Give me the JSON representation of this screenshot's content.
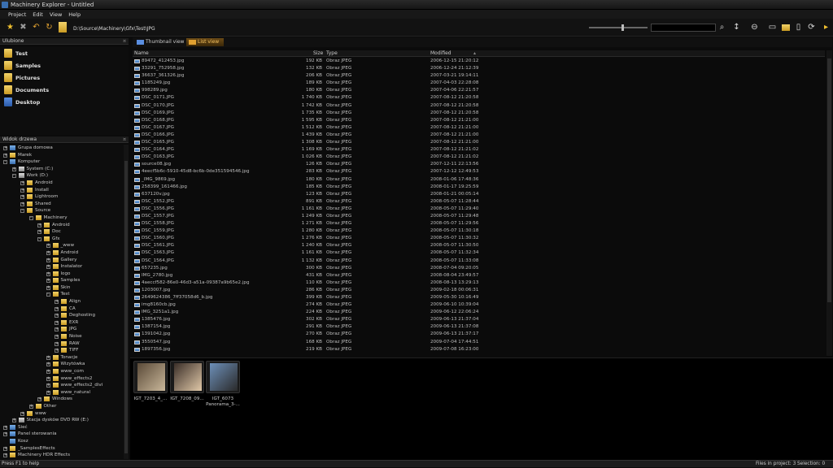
{
  "window": {
    "title": "Machinery Explorer - Untitled"
  },
  "menu": [
    "Project",
    "Edit",
    "View",
    "Help"
  ],
  "toolbar": {
    "path": "D:\\Source\\Machinery\\Gfx\\Test\\JPG"
  },
  "favorites": {
    "header": "Ulubione",
    "items": [
      {
        "label": "Test",
        "icon": "folder-icon"
      },
      {
        "label": "Samples",
        "icon": "folder-icon"
      },
      {
        "label": "Pictures",
        "icon": "folder-icon"
      },
      {
        "label": "Documents",
        "icon": "folder-icon"
      },
      {
        "label": "Desktop",
        "icon": "desktop-icon"
      }
    ]
  },
  "tree": {
    "header": "Widok drzewa",
    "items": [
      {
        "label": "Grupa domowa",
        "depth": 0,
        "exp": "+",
        "icon": "comp"
      },
      {
        "label": "Marek",
        "depth": 0,
        "exp": "+",
        "icon": "folder"
      },
      {
        "label": "Komputer",
        "depth": 0,
        "exp": "-",
        "icon": "comp"
      },
      {
        "label": "System (C:)",
        "depth": 1,
        "exp": "+",
        "icon": "drv"
      },
      {
        "label": "Work (D:)",
        "depth": 1,
        "exp": "-",
        "icon": "drv"
      },
      {
        "label": "Android",
        "depth": 2,
        "exp": "+",
        "icon": "folder"
      },
      {
        "label": "Install",
        "depth": 2,
        "exp": "+",
        "icon": "folder"
      },
      {
        "label": "Lightroom",
        "depth": 2,
        "exp": "+",
        "icon": "folder"
      },
      {
        "label": "Shared",
        "depth": 2,
        "exp": "+",
        "icon": "folder"
      },
      {
        "label": "Source",
        "depth": 2,
        "exp": "-",
        "icon": "folder"
      },
      {
        "label": "Machinery",
        "depth": 3,
        "exp": "-",
        "icon": "folder"
      },
      {
        "label": "Android",
        "depth": 4,
        "exp": "+",
        "icon": "folder"
      },
      {
        "label": "Doc",
        "depth": 4,
        "exp": "+",
        "icon": "folder"
      },
      {
        "label": "Gfx",
        "depth": 4,
        "exp": "-",
        "icon": "folder"
      },
      {
        "label": "_www",
        "depth": 5,
        "exp": "+",
        "icon": "folder"
      },
      {
        "label": "Android",
        "depth": 5,
        "exp": "+",
        "icon": "folder"
      },
      {
        "label": "Gallery",
        "depth": 5,
        "exp": "+",
        "icon": "folder"
      },
      {
        "label": "Instalator",
        "depth": 5,
        "exp": "+",
        "icon": "folder"
      },
      {
        "label": "logo",
        "depth": 5,
        "exp": "+",
        "icon": "folder"
      },
      {
        "label": "Samples",
        "depth": 5,
        "exp": "+",
        "icon": "folder"
      },
      {
        "label": "Skin",
        "depth": 5,
        "exp": "+",
        "icon": "folder"
      },
      {
        "label": "Test",
        "depth": 5,
        "exp": "-",
        "icon": "folder"
      },
      {
        "label": "Align",
        "depth": 6,
        "exp": "+",
        "icon": "folder"
      },
      {
        "label": "CA",
        "depth": 6,
        "exp": "+",
        "icon": "folder"
      },
      {
        "label": "Deghosting",
        "depth": 6,
        "exp": "+",
        "icon": "folder"
      },
      {
        "label": "EXR",
        "depth": 6,
        "exp": "+",
        "icon": "folder"
      },
      {
        "label": "JPG",
        "depth": 6,
        "exp": "+",
        "icon": "folder"
      },
      {
        "label": "Noise",
        "depth": 6,
        "exp": "+",
        "icon": "folder"
      },
      {
        "label": "RAW",
        "depth": 6,
        "exp": "+",
        "icon": "folder"
      },
      {
        "label": "TIFF",
        "depth": 6,
        "exp": "+",
        "icon": "folder"
      },
      {
        "label": "Tonacje",
        "depth": 5,
        "exp": "+",
        "icon": "folder"
      },
      {
        "label": "Wizytówka",
        "depth": 5,
        "exp": "+",
        "icon": "folder"
      },
      {
        "label": "www_com",
        "depth": 5,
        "exp": "+",
        "icon": "folder"
      },
      {
        "label": "www_effects2",
        "depth": 5,
        "exp": "+",
        "icon": "folder"
      },
      {
        "label": "www_effects2_divi",
        "depth": 5,
        "exp": "+",
        "icon": "folder"
      },
      {
        "label": "www_natural",
        "depth": 5,
        "exp": "+",
        "icon": "folder"
      },
      {
        "label": "Windows",
        "depth": 4,
        "exp": "+",
        "icon": "folder"
      },
      {
        "label": "Other",
        "depth": 3,
        "exp": "+",
        "icon": "folder"
      },
      {
        "label": "www",
        "depth": 2,
        "exp": "+",
        "icon": "folder"
      },
      {
        "label": "Stacja dysków DVD RW (E:)",
        "depth": 1,
        "exp": "+",
        "icon": "drv"
      },
      {
        "label": "Sieć",
        "depth": 0,
        "exp": "+",
        "icon": "comp"
      },
      {
        "label": "Panel sterowania",
        "depth": 0,
        "exp": "+",
        "icon": "comp"
      },
      {
        "label": "Kosz",
        "depth": 0,
        "exp": "",
        "icon": "comp"
      },
      {
        "label": "_SamplesEffects",
        "depth": 0,
        "exp": "+",
        "icon": "folder"
      },
      {
        "label": "Machinery HDR Effects",
        "depth": 0,
        "exp": "+",
        "icon": "folder"
      }
    ]
  },
  "view_tabs": [
    {
      "label": "Thumbnail view"
    },
    {
      "label": "List view"
    }
  ],
  "list": {
    "columns": {
      "name": "Name",
      "size": "Size",
      "type": "Type",
      "modified": "Modified"
    },
    "rows": [
      [
        "89472_412453.jpg",
        "192 KB",
        "Obraz JPEG",
        "2006-12-15 21:20:12"
      ],
      [
        "33291_752958.jpg",
        "132 KB",
        "Obraz JPEG",
        "2006-12-24 21:12:39"
      ],
      [
        "36637_361326.jpg",
        "206 KB",
        "Obraz JPEG",
        "2007-03-21 19:14:11"
      ],
      [
        "1185249.jpg",
        "189 KB",
        "Obraz JPEG",
        "2007-04-03 22:28:08"
      ],
      [
        "998289.jpg",
        "180 KB",
        "Obraz JPEG",
        "2007-04-06 22:21:57"
      ],
      [
        "DSC_0171.JPG",
        "1 740 KB",
        "Obraz JPEG",
        "2007-08-12 21:20:58"
      ],
      [
        "DSC_0170.JPG",
        "1 742 KB",
        "Obraz JPEG",
        "2007-08-12 21:20:58"
      ],
      [
        "DSC_0169.JPG",
        "1 735 KB",
        "Obraz JPEG",
        "2007-08-12 21:20:58"
      ],
      [
        "DSC_0168.JPG",
        "1 595 KB",
        "Obraz JPEG",
        "2007-08-12 21:21:00"
      ],
      [
        "DSC_0167.JPG",
        "1 512 KB",
        "Obraz JPEG",
        "2007-08-12 21:21:00"
      ],
      [
        "DSC_0166.JPG",
        "1 439 KB",
        "Obraz JPEG",
        "2007-08-12 21:21:00"
      ],
      [
        "DSC_0165.JPG",
        "1 308 KB",
        "Obraz JPEG",
        "2007-08-12 21:21:00"
      ],
      [
        "DSC_0164.JPG",
        "1 169 KB",
        "Obraz JPEG",
        "2007-08-12 21:21:02"
      ],
      [
        "DSC_0163.JPG",
        "1 026 KB",
        "Obraz JPEG",
        "2007-08-12 21:21:02"
      ],
      [
        "source08.jpg",
        "126 KB",
        "Obraz JPEG",
        "2007-12-11 22:13:56"
      ],
      [
        "4eecf5b6c-5910-45d8-bc6b-0de351594546.jpg",
        "283 KB",
        "Obraz JPEG",
        "2007-12-12 12:49:53"
      ],
      [
        "_IMG_9869.jpg",
        "180 KB",
        "Obraz JPEG",
        "2008-01-06 17:48:36"
      ],
      [
        "258399_161466.jpg",
        "185 KB",
        "Obraz JPEG",
        "2008-01-17 19:25:59"
      ],
      [
        "637120v.jpg",
        "123 KB",
        "Obraz JPEG",
        "2008-01-21 00:05:14"
      ],
      [
        "DSC_1552.JPG",
        "891 KB",
        "Obraz JPEG",
        "2008-05-07 11:28:44"
      ],
      [
        "DSC_1556.JPG",
        "1 161 KB",
        "Obraz JPEG",
        "2008-05-07 11:29:40"
      ],
      [
        "DSC_1557.JPG",
        "1 249 KB",
        "Obraz JPEG",
        "2008-05-07 11:29:48"
      ],
      [
        "DSC_1558.JPG",
        "1 271 KB",
        "Obraz JPEG",
        "2008-05-07 11:29:56"
      ],
      [
        "DSC_1559.JPG",
        "1 280 KB",
        "Obraz JPEG",
        "2008-05-07 11:30:18"
      ],
      [
        "DSC_1560.JPG",
        "1 276 KB",
        "Obraz JPEG",
        "2008-05-07 11:30:32"
      ],
      [
        "DSC_1561.JPG",
        "1 240 KB",
        "Obraz JPEG",
        "2008-05-07 11:30:50"
      ],
      [
        "DSC_1563.JPG",
        "1 161 KB",
        "Obraz JPEG",
        "2008-05-07 11:32:34"
      ],
      [
        "DSC_1564.JPG",
        "1 132 KB",
        "Obraz JPEG",
        "2008-05-07 11:33:08"
      ],
      [
        "657235.jpg",
        "300 KB",
        "Obraz JPEG",
        "2008-07-04 09:20:05"
      ],
      [
        "IMG_2780.jpg",
        "431 KB",
        "Obraz JPEG",
        "2008-08-04 23:49:57"
      ],
      [
        "4aeccf582-86e0-46d3-a51a-09387a9b65e2.jpg",
        "110 KB",
        "Obraz JPEG",
        "2008-08-13 13:29:13"
      ],
      [
        "1203007.jpg",
        "286 KB",
        "Obraz JPEG",
        "2009-02-18 00:06:31"
      ],
      [
        "2649624386_7ff37058d6_b.jpg",
        "399 KB",
        "Obraz JPEG",
        "2009-05-30 10:16:49"
      ],
      [
        "img8160cb.jpg",
        "274 KB",
        "Obraz JPEG",
        "2009-06-10 10:39:04"
      ],
      [
        "IMG_3251a1.jpg",
        "224 KB",
        "Obraz JPEG",
        "2009-06-12 22:06:24"
      ],
      [
        "1385476.jpg",
        "302 KB",
        "Obraz JPEG",
        "2009-06-13 21:37:04"
      ],
      [
        "1387154.jpg",
        "291 KB",
        "Obraz JPEG",
        "2009-06-13 21:37:08"
      ],
      [
        "1391042.jpg",
        "270 KB",
        "Obraz JPEG",
        "2009-06-13 21:37:17"
      ],
      [
        "3550547.jpg",
        "168 KB",
        "Obraz JPEG",
        "2009-07-04 17:44:51"
      ],
      [
        "1897356.jpg",
        "219 KB",
        "Obraz JPEG",
        "2009-07-08 16:23:00"
      ]
    ]
  },
  "project_items": [
    {
      "caption": "IGT_7203_4_...",
      "colors": [
        "#5a4a38",
        "#c9b79a"
      ]
    },
    {
      "caption": "IGT_7208_09...",
      "colors": [
        "#3a2e28",
        "#e0c8a8"
      ]
    },
    {
      "caption": "IGT_6073 Panorama_3-...",
      "colors": [
        "#6d8fb8",
        "#2a2a2a"
      ]
    }
  ],
  "status": {
    "hint": "Press F1 to help",
    "files": "Files in project: 3",
    "selected": "Selection: 0"
  },
  "colors": {
    "accent": "#e0a030",
    "folder": "#e8c050"
  }
}
